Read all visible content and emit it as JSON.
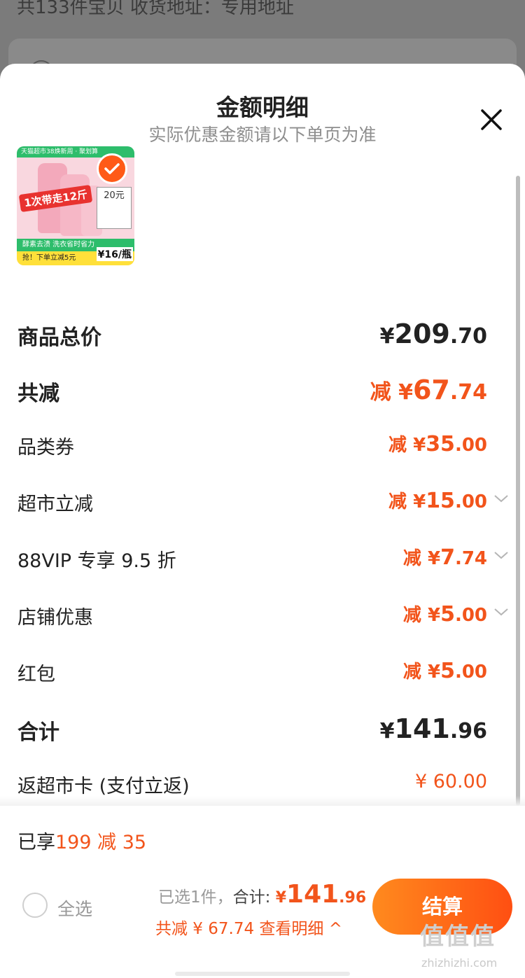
{
  "background": {
    "top_text": "共133件宝贝   收货地址：专用地址"
  },
  "sheet": {
    "title": "金额明细",
    "subtitle": "实际优惠金额请以下单页为准"
  },
  "product": {
    "thumb_top": "天猫超市38焕新周 · 聚划算",
    "thumb_banner": "1次带走12斤",
    "thumb_price_box": "20元",
    "thumb_green": "酵素去渍 洗衣省时省力",
    "thumb_yellow": "抢！下单立减5元",
    "thumb_unit_price": "¥16/瓶",
    "selected": true
  },
  "rows": [
    {
      "label": "商品总价",
      "prefix": "",
      "yen": "¥",
      "int": "209",
      "dec": ".70",
      "style": "total"
    },
    {
      "label": "共减",
      "prefix": "减 ",
      "yen": "¥",
      "int": "67",
      "dec": ".74",
      "style": "discount-total"
    },
    {
      "label": "品类券",
      "prefix": "减 ",
      "yen": "¥",
      "int": "35",
      "dec": ".00",
      "style": "discount"
    },
    {
      "label": "超市立减",
      "prefix": "减 ",
      "yen": "¥",
      "int": "15",
      "dec": ".00",
      "style": "discount",
      "expandable": true
    },
    {
      "label": "88VIP 专享 9.5 折",
      "prefix": "减 ",
      "yen": "¥",
      "int": "7",
      "dec": ".74",
      "style": "discount",
      "expandable": true
    },
    {
      "label": "店铺优惠",
      "prefix": "减 ",
      "yen": "¥",
      "int": "5",
      "dec": ".00",
      "style": "discount",
      "expandable": true
    },
    {
      "label": "红包",
      "prefix": "减 ",
      "yen": "¥",
      "int": "5",
      "dec": ".00",
      "style": "discount"
    },
    {
      "label": "合计",
      "prefix": "",
      "yen": "¥",
      "int": "141",
      "dec": ".96",
      "style": "total"
    },
    {
      "label": "返超市卡 (支付立返)",
      "value": "¥ 60.00",
      "style": "rebate"
    }
  ],
  "footer": {
    "promo_prefix": "已享",
    "promo_highlight": "199 减 35",
    "select_all": "全选",
    "selected_count": "已选1件，",
    "total_label": "合计:",
    "total_yen": "¥",
    "total_int": "141",
    "total_dec": ".96",
    "discount_text": "共减 ¥ 67.74",
    "detail_link": "查看明细 ^",
    "checkout": "结算"
  },
  "watermark": {
    "main": "值值值",
    "sub": "zhizhizhi.com"
  },
  "colors": {
    "accent": "#f2541b",
    "checkout_start": "#ff8a1e",
    "checkout_end": "#ff4f12"
  }
}
